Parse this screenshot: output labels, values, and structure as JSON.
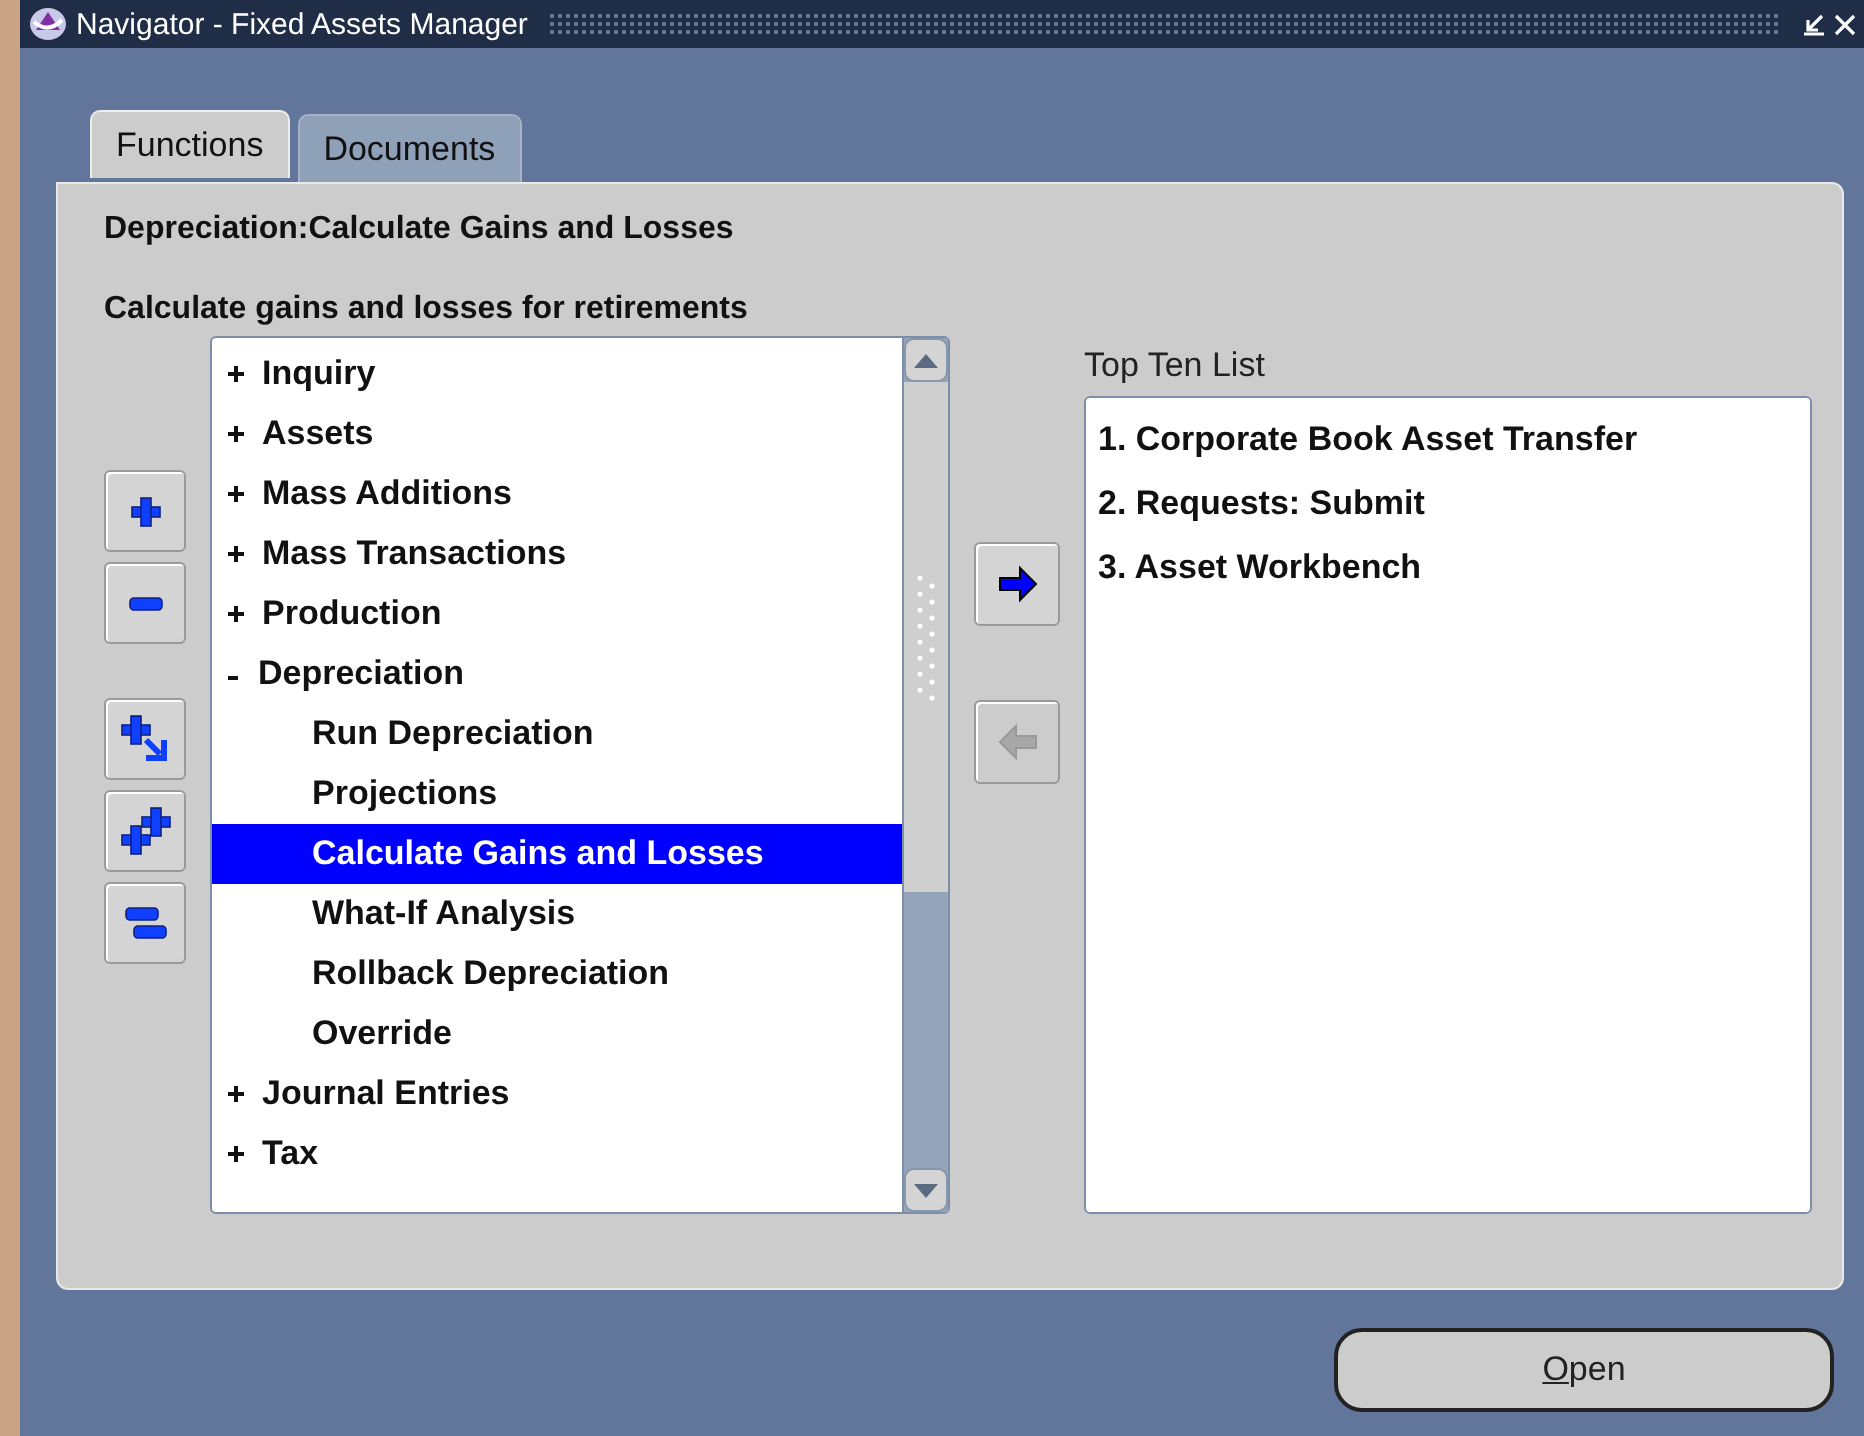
{
  "window": {
    "title": "Navigator - Fixed Assets Manager"
  },
  "tabs": [
    {
      "label": "Functions",
      "selected": true
    },
    {
      "label": "Documents",
      "selected": false
    }
  ],
  "heading": "Depreciation:Calculate Gains and Losses",
  "description": "Calculate gains and losses for retirements",
  "tree": [
    {
      "label": "Inquiry",
      "expanded": false,
      "selected": false
    },
    {
      "label": "Assets",
      "expanded": false,
      "selected": false
    },
    {
      "label": "Mass Additions",
      "expanded": false,
      "selected": false
    },
    {
      "label": "Mass Transactions",
      "expanded": false,
      "selected": false
    },
    {
      "label": "Production",
      "expanded": false,
      "selected": false
    },
    {
      "label": "Depreciation",
      "expanded": true,
      "selected": false,
      "children": [
        {
          "label": "Run Depreciation",
          "selected": false
        },
        {
          "label": "Projections",
          "selected": false
        },
        {
          "label": "Calculate Gains and Losses",
          "selected": true
        },
        {
          "label": "What-If Analysis",
          "selected": false
        },
        {
          "label": "Rollback Depreciation",
          "selected": false
        },
        {
          "label": "Override",
          "selected": false
        }
      ]
    },
    {
      "label": "Journal Entries",
      "expanded": false,
      "selected": false
    },
    {
      "label": "Tax",
      "expanded": false,
      "selected": false
    }
  ],
  "move_buttons": [
    {
      "kind": "add",
      "disabled": false
    },
    {
      "kind": "remove",
      "disabled": true
    }
  ],
  "top_ten": {
    "label": "Top Ten List",
    "items": [
      "1. Corporate Book Asset Transfer",
      "2. Requests: Submit",
      "3. Asset Workbench"
    ]
  },
  "open_button": "Open"
}
